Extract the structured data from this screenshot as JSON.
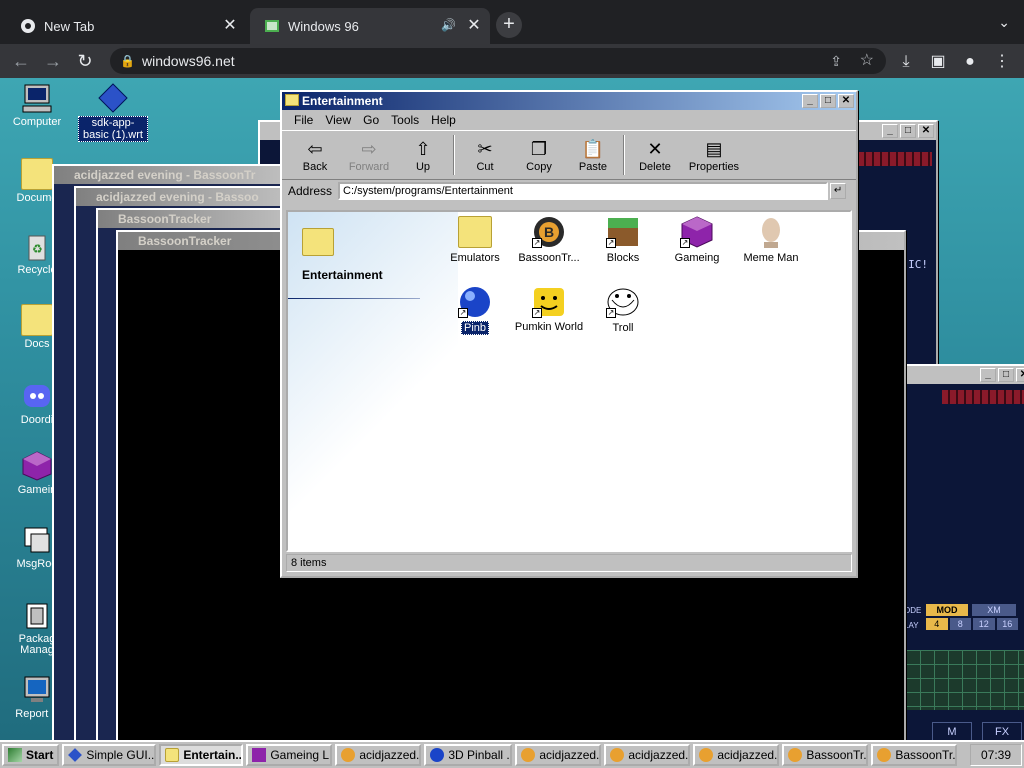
{
  "browser": {
    "tabs": [
      {
        "title": "New Tab"
      },
      {
        "title": "Windows 96"
      }
    ],
    "url": "windows96.net"
  },
  "desktop": {
    "icons": [
      {
        "label": "Computer"
      },
      {
        "label": "sdk-app-basic (1).wrt"
      },
      {
        "label": "Docume"
      },
      {
        "label": "Recycle"
      },
      {
        "label": "Docs"
      },
      {
        "label": "Doordi"
      },
      {
        "label": "Gamein"
      },
      {
        "label": "MsgRoo"
      },
      {
        "label": "Packag Manag"
      },
      {
        "label": "Report B"
      }
    ]
  },
  "bg_windows": [
    {
      "title": "acidjazzed evening - BassoonTr"
    },
    {
      "title": "acidjazzed evening - Bassoo"
    },
    {
      "title": "BassoonTracker"
    },
    {
      "title": "BassoonTracker"
    }
  ],
  "tracker_right": {
    "text1": "IC!",
    "mod_label": "MOD",
    "xm_label": "XM",
    "nums": [
      "8",
      "12",
      "16"
    ],
    "nums2": [
      "4",
      "8",
      "12",
      "16"
    ],
    "fx_label": "FX",
    "m_label": "M",
    "ode_label": "ODE",
    "lay_label": "LAY"
  },
  "explorer": {
    "title": "Entertainment",
    "menu": [
      "File",
      "View",
      "Go",
      "Tools",
      "Help"
    ],
    "tools": [
      "Back",
      "Forward",
      "Up",
      "Cut",
      "Copy",
      "Paste",
      "Delete",
      "Properties"
    ],
    "address_label": "Address",
    "address": "C:/system/programs/Entertainment",
    "folder_title": "Entertainment",
    "items": [
      {
        "label": "Emulators"
      },
      {
        "label": "BassoonTr..."
      },
      {
        "label": "Blocks"
      },
      {
        "label": "Gameing"
      },
      {
        "label": "Meme Man"
      },
      {
        "label": "Pinb"
      },
      {
        "label": "Pumkin World"
      },
      {
        "label": "Troll"
      }
    ],
    "status": "8 items"
  },
  "taskbar": {
    "start": "Start",
    "items": [
      "Simple GUI...",
      "Entertain...",
      "Gameing L...",
      "acidjazzed...",
      "3D Pinball ...",
      "acidjazzed...",
      "acidjazzed...",
      "acidjazzed...",
      "BassoonTr...",
      "BassoonTr..."
    ],
    "clock": "07:39"
  },
  "colors": {
    "titlebar_active": "#0a246a",
    "desktop": "#2f8fa0",
    "window_face": "#c0c0c0"
  }
}
